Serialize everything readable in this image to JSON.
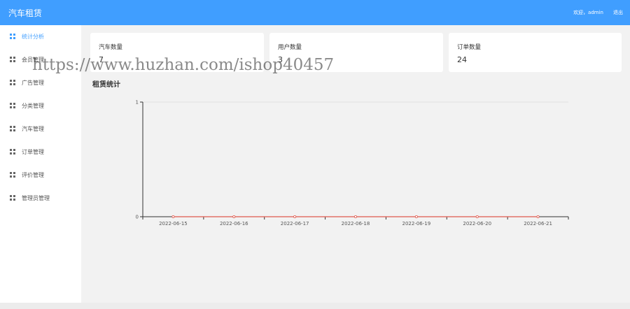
{
  "header": {
    "title": "汽车租赁",
    "welcome": "欢迎，admin",
    "logout": "退出"
  },
  "sidebar": {
    "items": [
      {
        "label": "统计分析",
        "active": true
      },
      {
        "label": "会员管理"
      },
      {
        "label": "广告管理"
      },
      {
        "label": "分类管理"
      },
      {
        "label": "汽车管理"
      },
      {
        "label": "订单管理"
      },
      {
        "label": "评价管理"
      },
      {
        "label": "管理员管理"
      }
    ]
  },
  "stats": [
    {
      "title": "汽车数量",
      "value": "7"
    },
    {
      "title": "用户数量",
      "value": "3"
    },
    {
      "title": "订单数量",
      "value": "24"
    }
  ],
  "section": {
    "title": "租赁统计"
  },
  "watermark": "https://www.huzhan.com/ishop40457",
  "colors": {
    "header": "#409eff",
    "line": "#e05a4e"
  },
  "chart_data": {
    "type": "line",
    "categories": [
      "2022-06-15",
      "2022-06-16",
      "2022-06-17",
      "2022-06-18",
      "2022-06-19",
      "2022-06-20",
      "2022-06-21"
    ],
    "series": [
      {
        "values": [
          0,
          0,
          0,
          0,
          0,
          0,
          0
        ]
      }
    ],
    "ylim": [
      0,
      1
    ],
    "yticks": [
      "0",
      "1"
    ],
    "grid": true,
    "title": "",
    "xlabel": "",
    "ylabel": ""
  }
}
